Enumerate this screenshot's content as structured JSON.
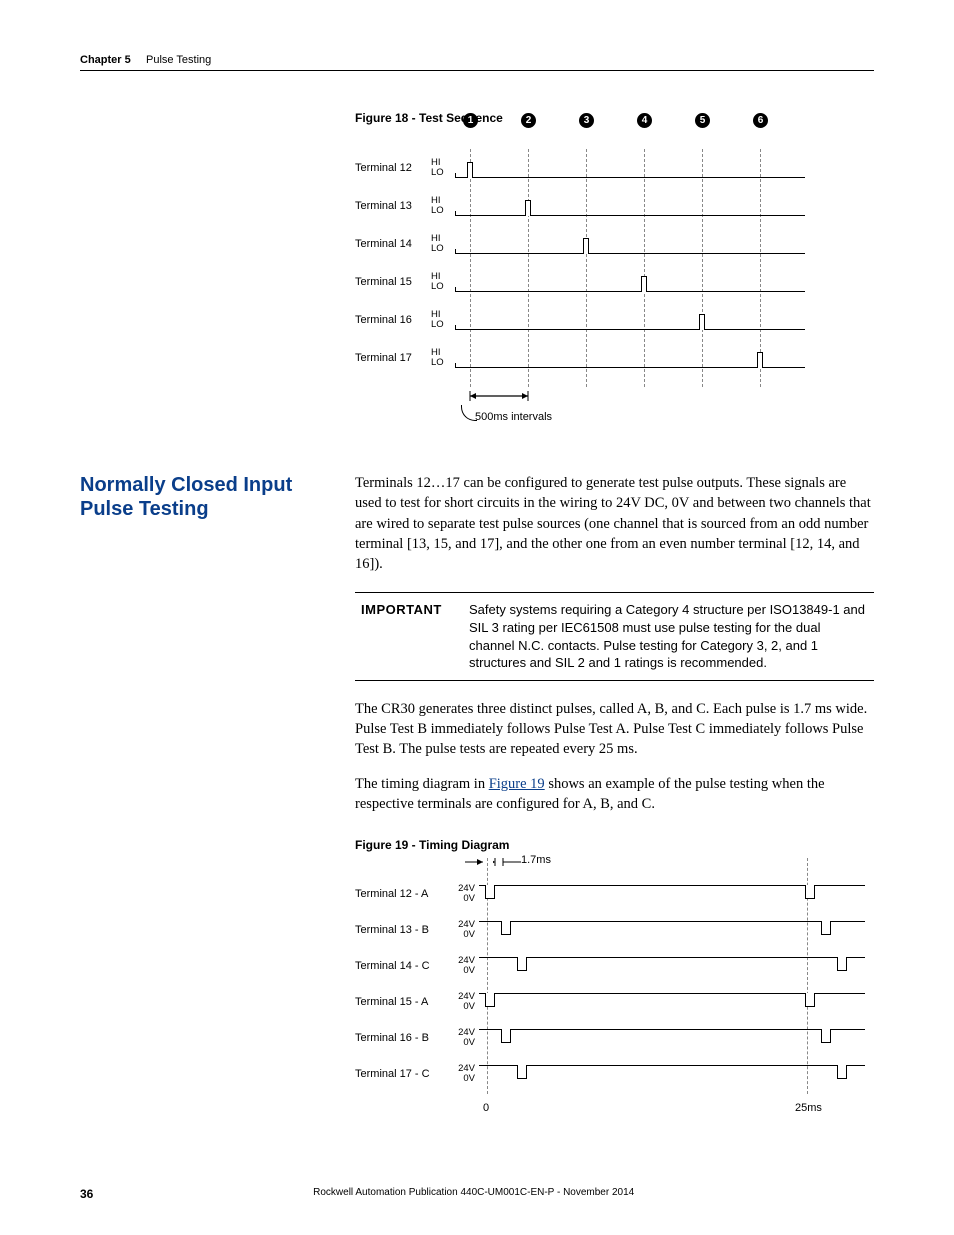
{
  "header": {
    "chapter": "Chapter 5",
    "title": "Pulse Testing"
  },
  "figure18": {
    "caption": "Figure 18 - Test Sequence",
    "interval_label": "500ms intervals",
    "markers": [
      "1",
      "2",
      "3",
      "4",
      "5",
      "6"
    ],
    "rows": [
      {
        "label": "Terminal 12",
        "hi": "HI",
        "lo": "LO"
      },
      {
        "label": "Terminal 13",
        "hi": "HI",
        "lo": "LO"
      },
      {
        "label": "Terminal 14",
        "hi": "HI",
        "lo": "LO"
      },
      {
        "label": "Terminal 15",
        "hi": "HI",
        "lo": "LO"
      },
      {
        "label": "Terminal 16",
        "hi": "HI",
        "lo": "LO"
      },
      {
        "label": "Terminal 17",
        "hi": "HI",
        "lo": "LO"
      }
    ]
  },
  "section": {
    "heading": "Normally Closed Input Pulse Testing",
    "para1": "Terminals 12…17 can be configured to generate test pulse outputs. These signals are used to test for short circuits in the wiring to 24V DC, 0V and between two channels that are wired to separate test pulse sources (one channel that is sourced from an odd number terminal [13, 15, and 17], and the other one from an even number terminal [12, 14, and 16]).",
    "important_label": "IMPORTANT",
    "important_text": "Safety systems requiring a Category 4 structure per ISO13849-1 and SIL 3 rating per IEC61508 must use pulse testing for the dual channel N.C. contacts. Pulse testing for Category 3, 2, and 1 structures and SIL 2 and 1 ratings is recommended.",
    "para2": "The CR30 generates three distinct pulses, called A, B, and C. Each pulse is 1.7 ms wide. Pulse Test B immediately follows Pulse Test A. Pulse Test C immediately follows Pulse Test B. The pulse tests are repeated every 25 ms.",
    "para3_pre": "The timing diagram in ",
    "para3_link": "Figure 19",
    "para3_post": " shows an example of the pulse testing when the respective terminals are configured for A, B, and C."
  },
  "figure19": {
    "caption": "Figure 19 - Timing Diagram",
    "pulse_width_label": "1.7ms",
    "x0": "0",
    "x1": "25ms",
    "rows": [
      {
        "label": "Terminal 12 - A",
        "hi": "24V",
        "lo": "0V"
      },
      {
        "label": "Terminal 13 - B",
        "hi": "24V",
        "lo": "0V"
      },
      {
        "label": "Terminal 14 - C",
        "hi": "24V",
        "lo": "0V"
      },
      {
        "label": "Terminal 15 - A",
        "hi": "24V",
        "lo": "0V"
      },
      {
        "label": "Terminal 16 - B",
        "hi": "24V",
        "lo": "0V"
      },
      {
        "label": "Terminal 17 - C",
        "hi": "24V",
        "lo": "0V"
      }
    ]
  },
  "footer": {
    "page": "36",
    "pub": "Rockwell Automation Publication 440C-UM001C-EN-P - November 2014"
  },
  "chart_data": [
    {
      "type": "timing",
      "title": "Figure 18 - Test Sequence",
      "x_unit": "ms",
      "interval_ms": 500,
      "markers": [
        1,
        2,
        3,
        4,
        5,
        6
      ],
      "terminals": [
        {
          "name": "Terminal 12",
          "levels": [
            "HI",
            "LO"
          ],
          "pulse_at_marker": 1
        },
        {
          "name": "Terminal 13",
          "levels": [
            "HI",
            "LO"
          ],
          "pulse_at_marker": 2
        },
        {
          "name": "Terminal 14",
          "levels": [
            "HI",
            "LO"
          ],
          "pulse_at_marker": 3
        },
        {
          "name": "Terminal 15",
          "levels": [
            "HI",
            "LO"
          ],
          "pulse_at_marker": 4
        },
        {
          "name": "Terminal 16",
          "levels": [
            "HI",
            "LO"
          ],
          "pulse_at_marker": 5
        },
        {
          "name": "Terminal 17",
          "levels": [
            "HI",
            "LO"
          ],
          "pulse_at_marker": 6
        }
      ]
    },
    {
      "type": "timing",
      "title": "Figure 19 - Timing Diagram",
      "x_unit": "ms",
      "pulse_width_ms": 1.7,
      "period_ms": 25,
      "terminals": [
        {
          "name": "Terminal 12 - A",
          "levels": [
            "24V",
            "0V"
          ],
          "pulse_group": "A",
          "pulse_start_ms": 0.0
        },
        {
          "name": "Terminal 13 - B",
          "levels": [
            "24V",
            "0V"
          ],
          "pulse_group": "B",
          "pulse_start_ms": 1.7
        },
        {
          "name": "Terminal 14 - C",
          "levels": [
            "24V",
            "0V"
          ],
          "pulse_group": "C",
          "pulse_start_ms": 3.4
        },
        {
          "name": "Terminal 15 - A",
          "levels": [
            "24V",
            "0V"
          ],
          "pulse_group": "A",
          "pulse_start_ms": 0.0
        },
        {
          "name": "Terminal 16 - B",
          "levels": [
            "24V",
            "0V"
          ],
          "pulse_group": "B",
          "pulse_start_ms": 1.7
        },
        {
          "name": "Terminal 17 - C",
          "levels": [
            "24V",
            "0V"
          ],
          "pulse_group": "C",
          "pulse_start_ms": 3.4
        }
      ],
      "x_ticks": [
        0,
        25
      ]
    }
  ]
}
